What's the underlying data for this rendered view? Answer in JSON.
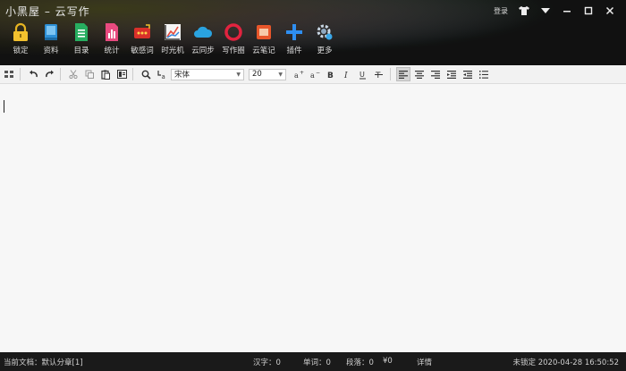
{
  "app": {
    "title": "小黑屋 – 云写作"
  },
  "window": {
    "login_label": "登录"
  },
  "toolbar": {
    "items": [
      {
        "label": "锁定",
        "icon": "lock-icon"
      },
      {
        "label": "资料",
        "icon": "book-icon"
      },
      {
        "label": "目录",
        "icon": "document-list-icon"
      },
      {
        "label": "统计",
        "icon": "bar-stats-icon"
      },
      {
        "label": "敏感词",
        "icon": "sensitive-words-icon"
      },
      {
        "label": "时光机",
        "icon": "chart-timeline-icon"
      },
      {
        "label": "云同步",
        "icon": "cloud-icon"
      },
      {
        "label": "写作圈",
        "icon": "circle-ring-icon"
      },
      {
        "label": "云笔记",
        "icon": "note-icon"
      },
      {
        "label": "插件",
        "icon": "plus-icon"
      },
      {
        "label": "更多",
        "icon": "gear-more-icon"
      }
    ]
  },
  "format": {
    "font_name": "宋体",
    "font_size": "20"
  },
  "status": {
    "current_doc": "当前文档：默认分章[1]",
    "chars": "汉字：0",
    "words": "单词：0",
    "paragraphs": "段落：0",
    "money": "¥0",
    "details": "详情",
    "lock_time": "未锁定 2020-04-28 16:50:52"
  },
  "colors": {
    "topbar": "#111111",
    "status_bar": "#1a1a1a",
    "editor_bg": "#f7f7f7"
  }
}
